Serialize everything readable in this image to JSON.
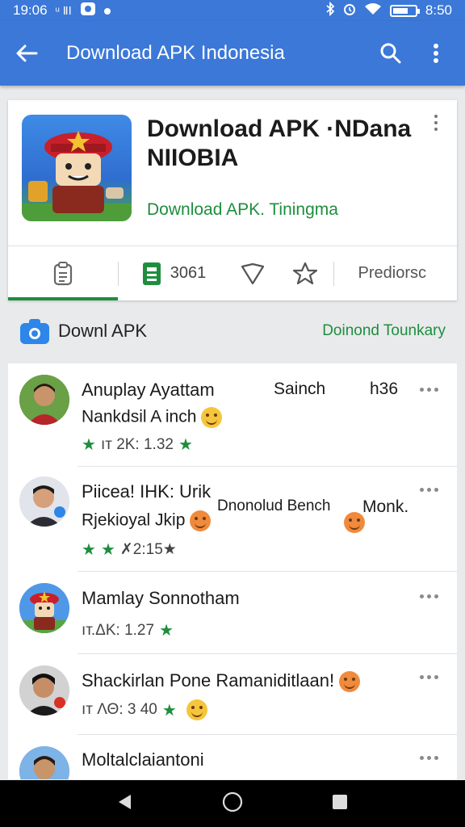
{
  "status": {
    "time": "19:06",
    "left_box1": "ᵘ ⅡⅠ",
    "right_time": "8:50"
  },
  "header": {
    "title": "Download APK Indonesia"
  },
  "app": {
    "title_line1": "Download APK ·NDana",
    "title_line2": "NIIOBIA",
    "subtitle": "Download APK. Tiningma",
    "actions": {
      "count": "3061",
      "label": "Prediorsc"
    }
  },
  "section": {
    "title": "Downl APK",
    "link": "Doinond Tounkary"
  },
  "items": [
    {
      "name": "Anuplay Ayattam",
      "extra1": "Sainch",
      "extra2": "h36",
      "sub": "Nankdsil A inch",
      "rating": "ıт 2K: 1.32"
    },
    {
      "name": "Piicea! IHK: Urik",
      "extra1": "Dnonolud Bench",
      "extra2": "Monk.",
      "sub": "Rjekioyal Jkip",
      "rating": "✗2:15★"
    },
    {
      "name": "Mamlay Sonnotham",
      "rating": "ıт.ΔΚ: 1.27"
    },
    {
      "name": "Shackirlan Pone Ramaniditlaan!",
      "rating": "ıт ΛΘ: 3 40"
    },
    {
      "name": "Moltalclaiantoni",
      "rating": ""
    }
  ],
  "colors": {
    "primary": "#3b78d8",
    "accent_green": "#1e8e3e"
  }
}
